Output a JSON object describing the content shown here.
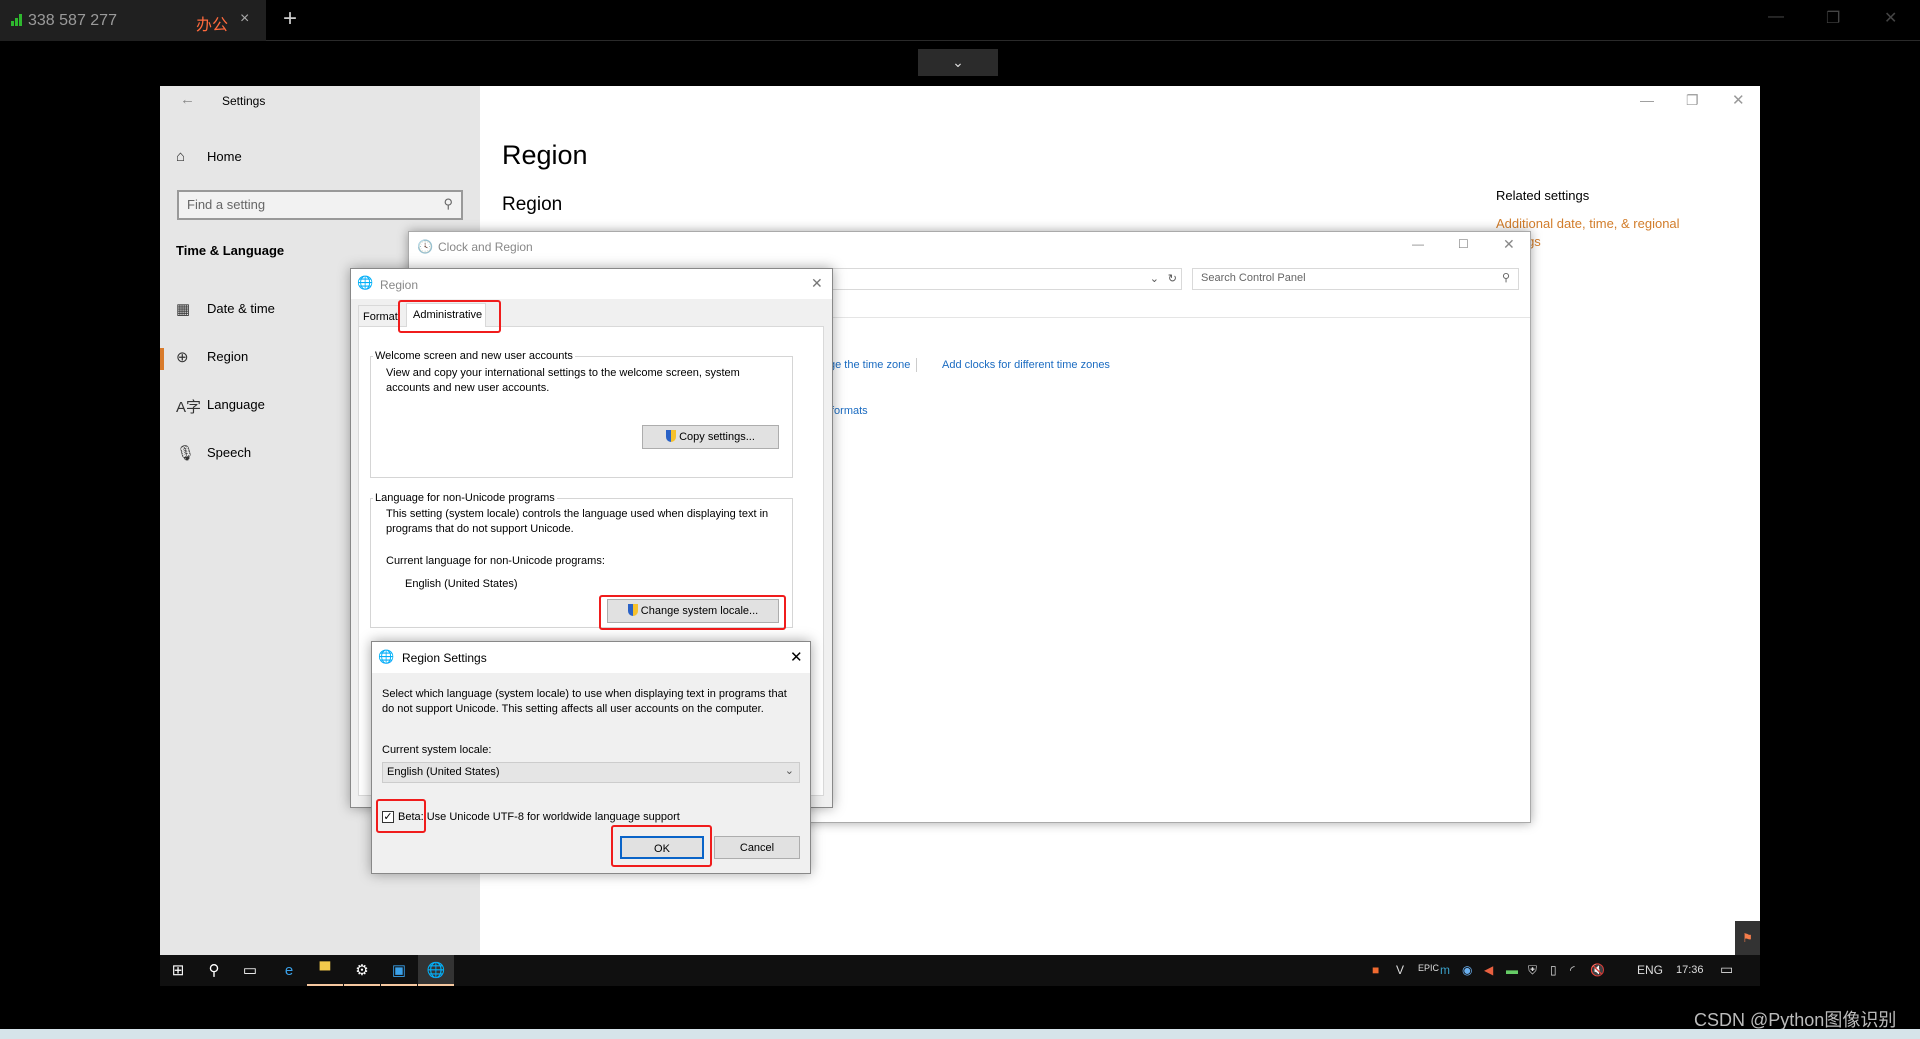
{
  "remote_bar": {
    "session_id": "338 587 277",
    "tab_name": "办公",
    "close": "×",
    "new_tab": "+",
    "minimize": "—",
    "restore": "❐",
    "close_window": "✕",
    "collapse": "⌄"
  },
  "settings": {
    "title": "Settings",
    "back": "←",
    "home": "Home",
    "search_placeholder": "Find a setting",
    "section": "Time & Language",
    "nav": [
      {
        "label": "Date & time",
        "icon": "calendar-clock-icon"
      },
      {
        "label": "Region",
        "icon": "globe-icon",
        "active": true
      },
      {
        "label": "Language",
        "icon": "language-icon"
      },
      {
        "label": "Speech",
        "icon": "microphone-icon"
      }
    ],
    "page_title": "Region",
    "subtitle": "Region",
    "related_title": "Related settings",
    "related_link": "Additional date, time, & regional settings",
    "accent": "#d97b2b"
  },
  "clock_region": {
    "title": "Clock and Region",
    "search_placeholder": "Search Control Panel",
    "link_timezone": "ge the time zone",
    "link_clocks": "Add clocks for different time zones",
    "link_formats": "formats"
  },
  "region_dialog": {
    "title": "Region",
    "tabs": [
      "Formats",
      "Administrative"
    ],
    "active_tab": "Administrative",
    "group1_label": "Welcome screen and new user accounts",
    "group1_text": "View and copy your international settings to the welcome screen, system accounts and new user accounts.",
    "copy_button": "Copy settings...",
    "group2_label": "Language for non-Unicode programs",
    "group2_text": "This setting (system locale) controls the language used when displaying text in programs that do not support Unicode.",
    "current_label": "Current language for non-Unicode programs:",
    "current_value": "English (United States)",
    "change_button": "Change system locale..."
  },
  "region_settings": {
    "title": "Region Settings",
    "description": "Select which language (system locale) to use when displaying text in programs that do not support Unicode. This setting affects all user accounts on the computer.",
    "locale_label": "Current system locale:",
    "locale_value": "English (United States)",
    "beta_checkbox": "Beta: Use Unicode UTF-8 for worldwide language support",
    "beta_checked": true,
    "ok": "OK",
    "cancel": "Cancel",
    "highlight_color": "#f01c1c"
  },
  "taskbar": {
    "lang": "ENG",
    "time": "17:36"
  },
  "watermark": "CSDN @Python图像识别"
}
